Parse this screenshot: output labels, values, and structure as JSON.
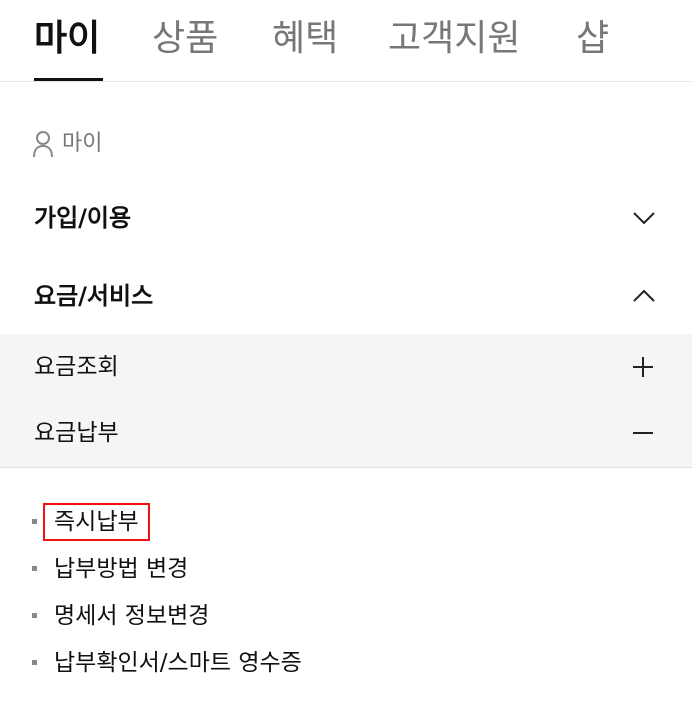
{
  "tabs": [
    {
      "label": "마이",
      "active": true
    },
    {
      "label": "상품",
      "active": false
    },
    {
      "label": "혜택",
      "active": false
    },
    {
      "label": "고객지원",
      "active": false
    },
    {
      "label": "샵",
      "active": false
    }
  ],
  "breadcrumb": {
    "icon": "person-icon",
    "label": "마이"
  },
  "sections": [
    {
      "title": "가입/이용",
      "expanded": false,
      "icon": "chevron-down-icon"
    },
    {
      "title": "요금/서비스",
      "expanded": true,
      "icon": "chevron-up-icon"
    }
  ],
  "subitems": [
    {
      "title": "요금조회",
      "icon": "plus-icon"
    },
    {
      "title": "요금납부",
      "icon": "minus-icon"
    }
  ],
  "leaves": [
    {
      "label": "즉시납부",
      "highlighted": true
    },
    {
      "label": "납부방법 변경",
      "highlighted": false
    },
    {
      "label": "명세서 정보변경",
      "highlighted": false
    },
    {
      "label": "납부확인서/스마트 영수증",
      "highlighted": false
    }
  ],
  "colors": {
    "highlight_border": "#e11111",
    "panel_bg": "#f5f5f5",
    "inactive_tab": "#777777"
  }
}
